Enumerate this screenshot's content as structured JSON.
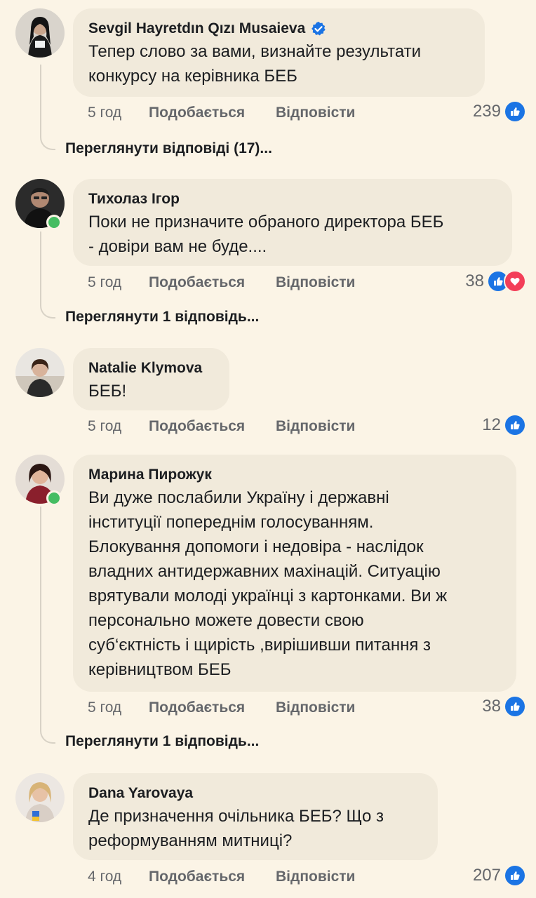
{
  "comments": [
    {
      "author": "Sevgil Hayretdın Qızı Musaieva",
      "verified": true,
      "text": "Тепер слово за вами, визнайте результати\nконкурсу на керівника  БЕБ",
      "time": "5 год",
      "like_label": "Подобається",
      "reply_label": "Відповісти",
      "reaction_count": "239",
      "reactions": [
        "like"
      ],
      "view_replies": "Переглянути відповіді (17)..."
    },
    {
      "author": "Тихолаз Ігор",
      "text": "Поки не призначите обраного директора БЕБ\n- довіри вам не буде....",
      "time": "5 год",
      "like_label": "Подобається",
      "reply_label": "Відповісти",
      "reaction_count": "38",
      "reactions": [
        "like",
        "love"
      ],
      "online": true,
      "view_replies": "Переглянути 1 відповідь..."
    },
    {
      "author": "Natalie Klymova",
      "text": "БЕБ!",
      "time": "5 год",
      "like_label": "Подобається",
      "reply_label": "Відповісти",
      "reaction_count": "12",
      "reactions": [
        "like"
      ]
    },
    {
      "author": "Марина Пирожук",
      "text": "Ви дуже послабили Україну і державні\nінституції попереднім голосуванням.\nБлокування допомоги і недовіра - наслідок\nвладних антидержавних махінацій. Ситуацію\nврятували молоді українці з картонками. Ви ж\nперсонально можете довести свою\nсуб‘єктність і щирість  ,вирішивши питання з\nкерівництвом БЕБ",
      "time": "5 год",
      "like_label": "Подобається",
      "reply_label": "Відповісти",
      "reaction_count": "38",
      "reactions": [
        "like"
      ],
      "online": true,
      "view_replies": "Переглянути 1 відповідь..."
    },
    {
      "author": "Dana  Yarovaya",
      "text": "Де призначення очільника БЕБ? Що з\nреформуванням митниці?",
      "time": "4 год",
      "like_label": "Подобається",
      "reply_label": "Відповісти",
      "reaction_count": "207",
      "reactions": [
        "like"
      ]
    }
  ],
  "colors": {
    "background": "#fbf4e6",
    "bubble": "#f1eadb",
    "like_blue": "#1b74e4",
    "love_red": "#f33e58",
    "online_green": "#45bd62",
    "meta_gray": "#65676b"
  },
  "icons": [
    "verified-badge-icon",
    "like-reaction-icon",
    "love-reaction-icon"
  ]
}
